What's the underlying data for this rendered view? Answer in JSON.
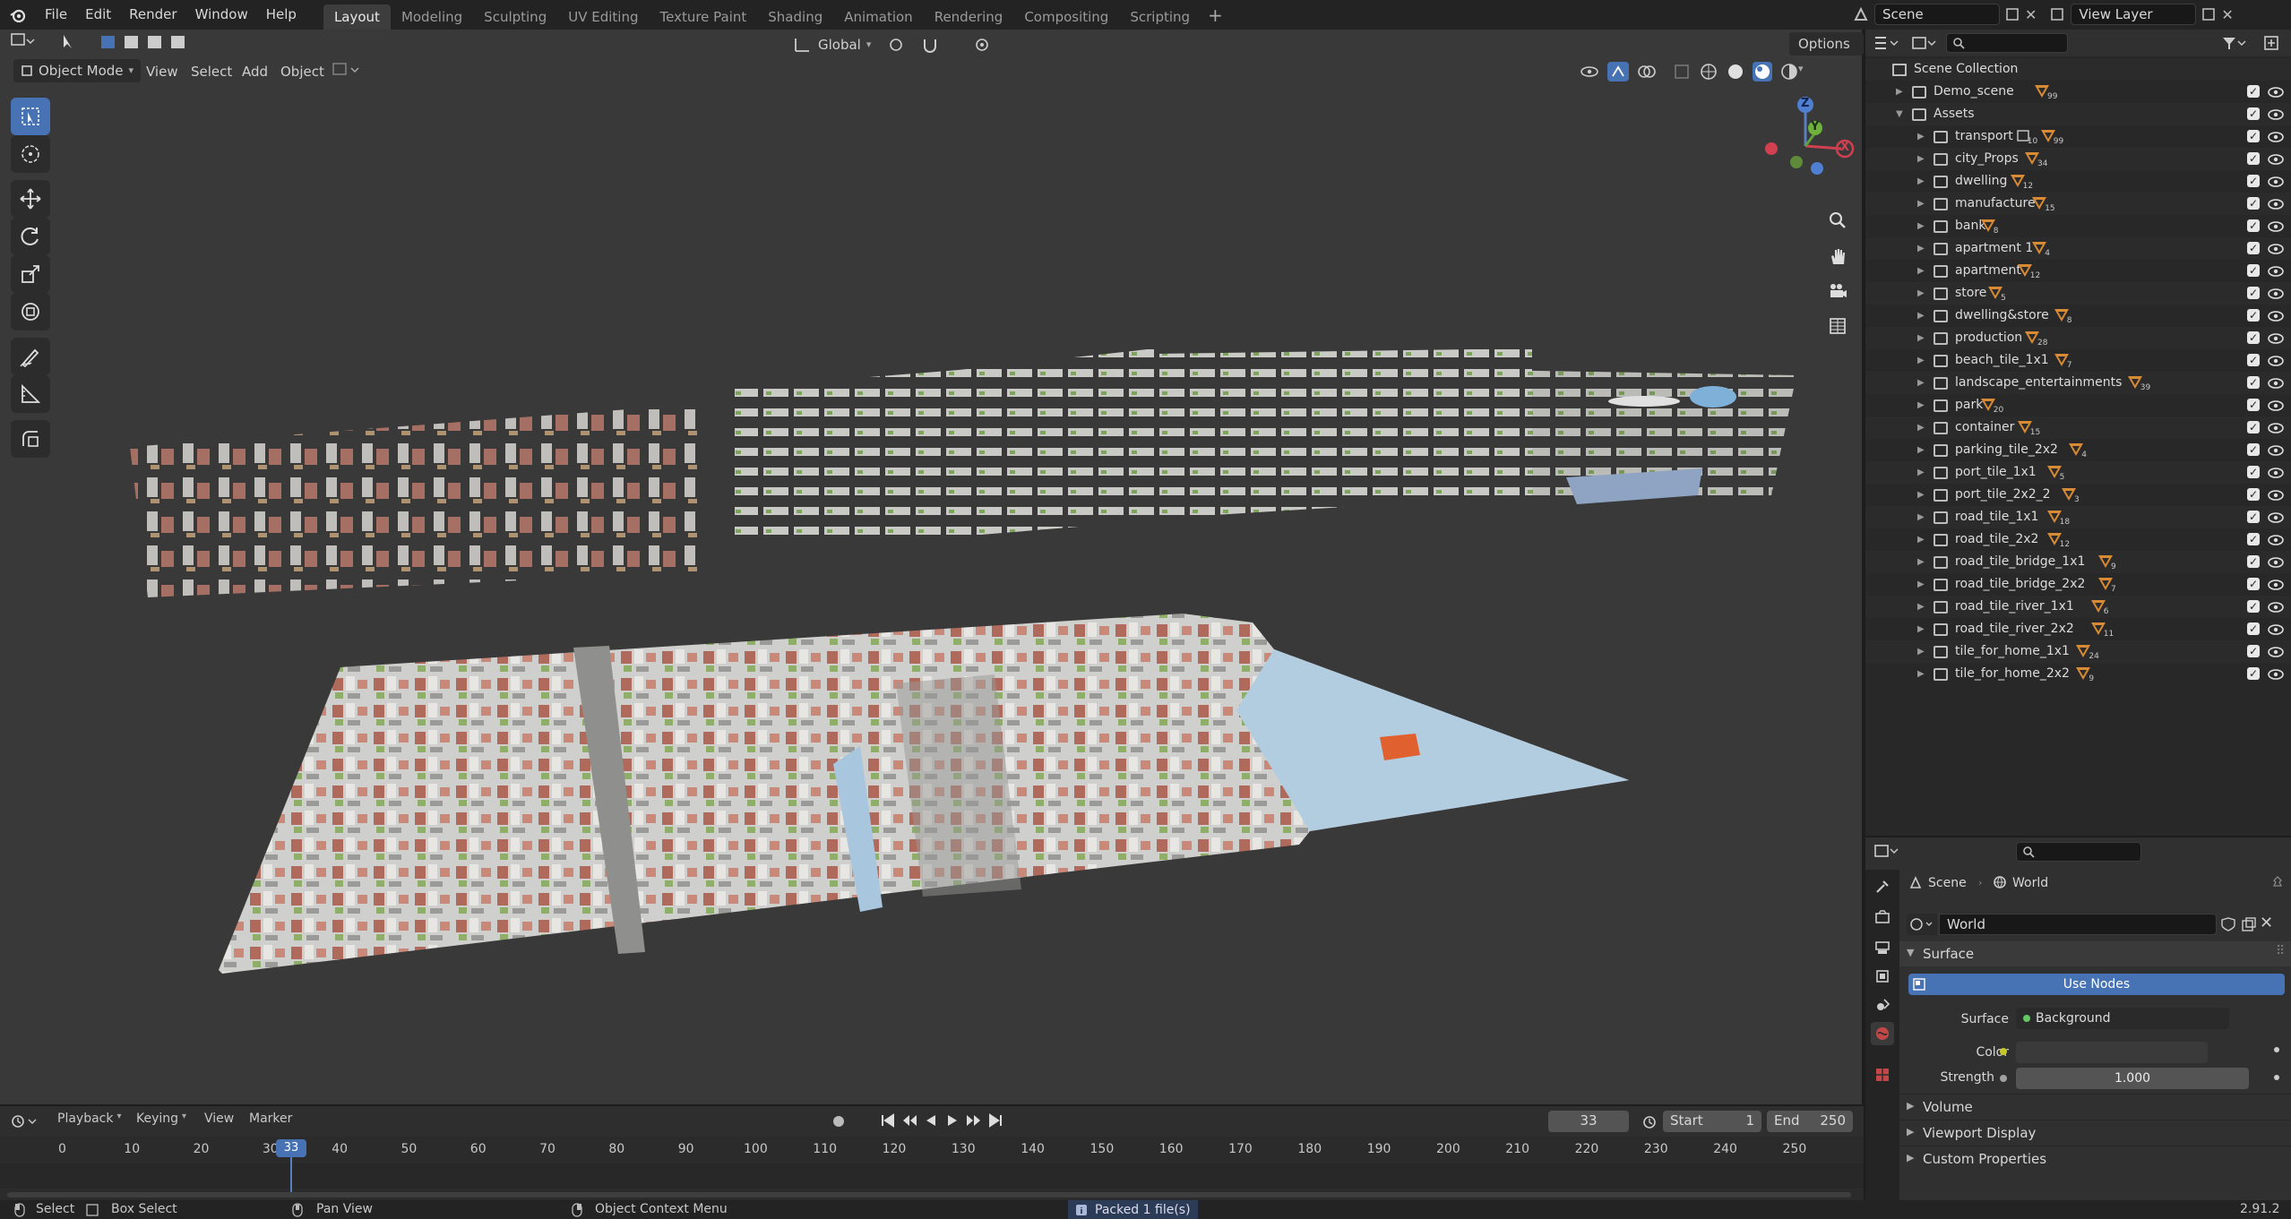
{
  "menu": {
    "file": "File",
    "edit": "Edit",
    "render": "Render",
    "window": "Window",
    "help": "Help"
  },
  "workspaces": [
    "Layout",
    "Modeling",
    "Sculpting",
    "UV Editing",
    "Texture Paint",
    "Shading",
    "Animation",
    "Rendering",
    "Compositing",
    "Scripting"
  ],
  "scene_field": "Scene",
  "view_layer_field": "View Layer",
  "viewport": {
    "mode": "Object Mode",
    "view": "View",
    "select": "Select",
    "add": "Add",
    "object": "Object",
    "orientation": "Global",
    "options": "Options"
  },
  "gizmo": {
    "z": "Z",
    "y": "Y",
    "x": "X"
  },
  "outliner": {
    "root": "Scene Collection",
    "demo": {
      "label": "Demo_scene",
      "count": "99"
    },
    "assets": "Assets",
    "items": [
      {
        "label": "transport",
        "count": "99",
        "extra": "10"
      },
      {
        "label": "city_Props",
        "count": "34"
      },
      {
        "label": "dwelling",
        "count": "12"
      },
      {
        "label": "manufacture",
        "count": "15"
      },
      {
        "label": "bank",
        "count": "8"
      },
      {
        "label": "apartment 1",
        "count": "4"
      },
      {
        "label": "apartment",
        "count": "12"
      },
      {
        "label": "store",
        "count": "5"
      },
      {
        "label": "dwelling&store",
        "count": "8"
      },
      {
        "label": "production",
        "count": "28"
      },
      {
        "label": "beach_tile_1x1",
        "count": "7"
      },
      {
        "label": "landscape_entertainments",
        "count": "39"
      },
      {
        "label": "park",
        "count": "20"
      },
      {
        "label": "container",
        "count": "15"
      },
      {
        "label": "parking_tile_2x2",
        "count": "4"
      },
      {
        "label": "port_tile_1x1",
        "count": "5"
      },
      {
        "label": "port_tile_2x2_2",
        "count": "3"
      },
      {
        "label": "road_tile_1x1",
        "count": "18"
      },
      {
        "label": "road_tile_2x2",
        "count": "12"
      },
      {
        "label": "road_tile_bridge_1x1",
        "count": "9"
      },
      {
        "label": "road_tile_bridge_2x2",
        "count": "7"
      },
      {
        "label": "road_tile_river_1x1",
        "count": "6"
      },
      {
        "label": "road_tile_river_2x2",
        "count": "11"
      },
      {
        "label": "tile_for_home_1x1",
        "count": "24"
      },
      {
        "label": "tile_for_home_2x2",
        "count": "9"
      }
    ]
  },
  "properties": {
    "crumb_scene": "Scene",
    "crumb_world": "World",
    "world_name": "World",
    "surface_panel": "Surface",
    "use_nodes": "Use Nodes",
    "surface_label": "Surface",
    "surface_value": "Background",
    "color_label": "Color",
    "strength_label": "Strength",
    "strength_value": "1.000",
    "volume": "Volume",
    "viewport_display": "Viewport Display",
    "custom_properties": "Custom Properties"
  },
  "timeline": {
    "playback": "Playback",
    "keying": "Keying",
    "view": "View",
    "marker": "Marker",
    "current_frame": "33",
    "start_label": "Start",
    "start_value": "1",
    "end_label": "End",
    "end_value": "250",
    "ticks": [
      "0",
      "10",
      "20",
      "30",
      "40",
      "50",
      "60",
      "70",
      "80",
      "90",
      "100",
      "110",
      "120",
      "130",
      "140",
      "150",
      "160",
      "170",
      "180",
      "190",
      "200",
      "210",
      "220",
      "230",
      "240",
      "250"
    ],
    "playhead": "33"
  },
  "status": {
    "select": "Select",
    "box_select": "Box Select",
    "pan_view": "Pan View",
    "context_menu": "Object Context Menu",
    "packed": "Packed 1 file(s)",
    "version": "2.91.2"
  },
  "colors": {
    "accent": "#4772b3",
    "header": "#232323",
    "viewport": "#393939",
    "panel": "#282828"
  }
}
